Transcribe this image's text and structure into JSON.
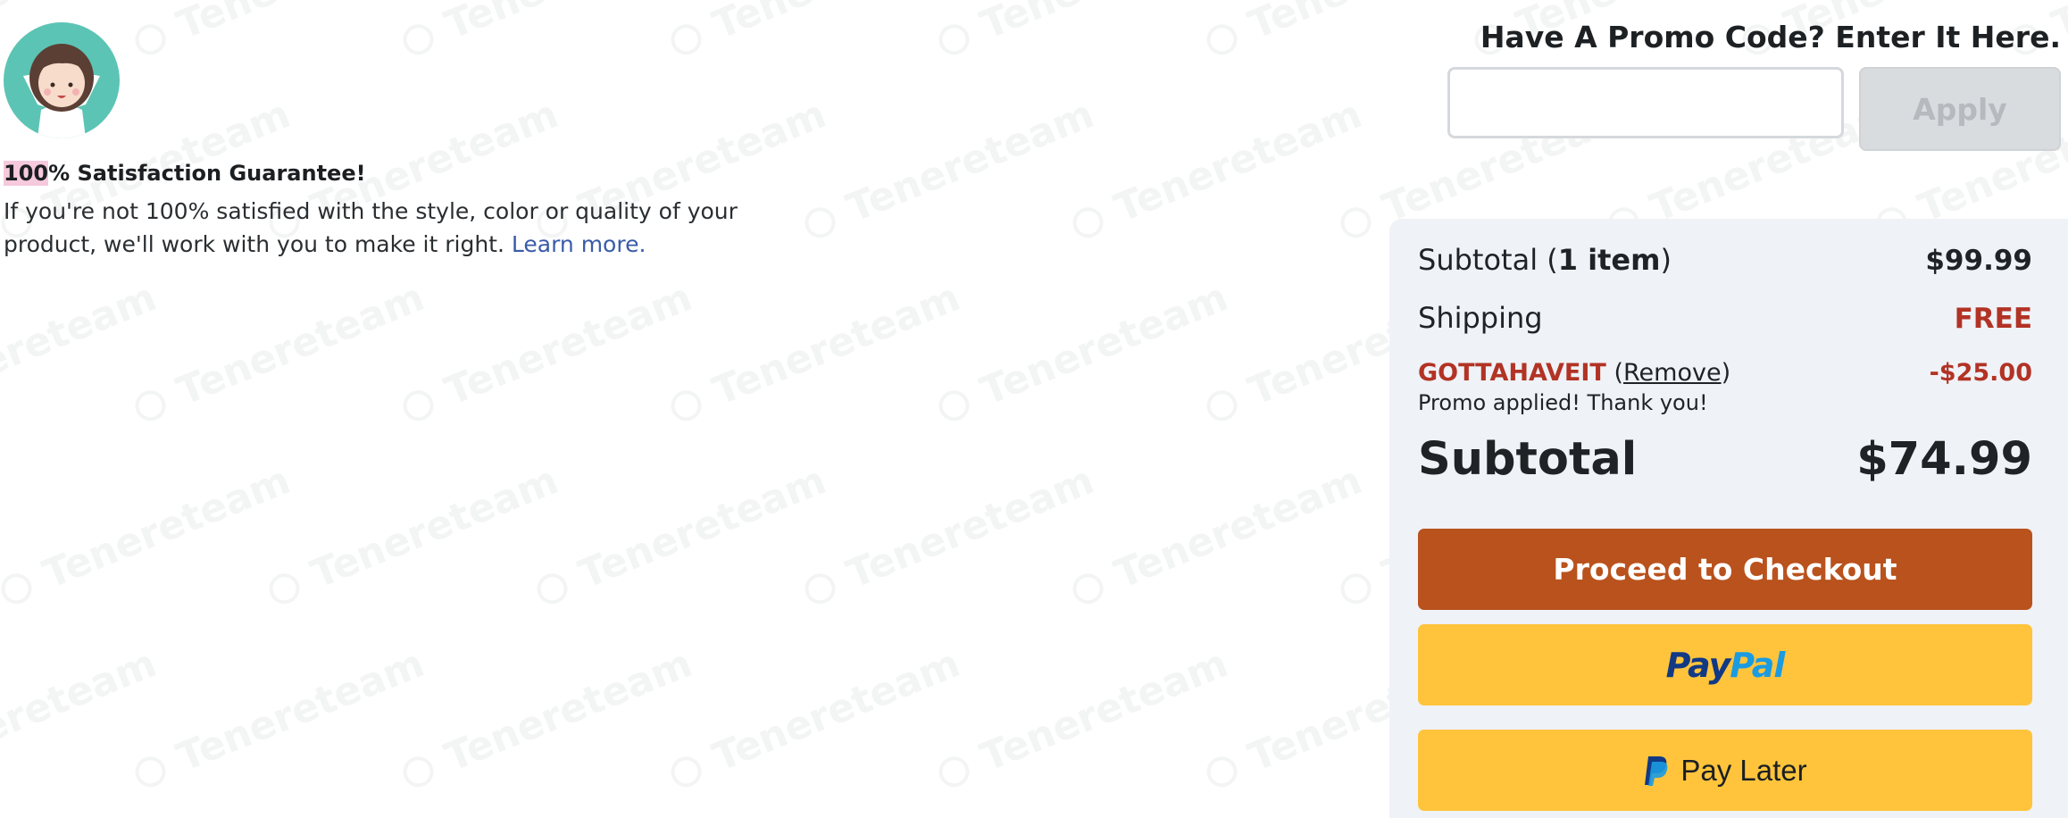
{
  "watermark": {
    "text": "Tenereteam"
  },
  "guarantee": {
    "title_highlight": "100",
    "title_rest": "% Satisfaction Guarantee!",
    "text": "If you're not 100% satisfied with the style, color or quality of your product, we'll work with you to make it right.",
    "link": "Learn more."
  },
  "promo": {
    "title": "Have A Promo Code? Enter It Here.",
    "input_value": "",
    "apply_label": "Apply"
  },
  "summary": {
    "subtotal_label_prefix": "Subtotal (",
    "subtotal_items": "1 item",
    "subtotal_label_suffix": ")",
    "subtotal_value": "$99.99",
    "shipping_label": "Shipping",
    "shipping_value": "FREE",
    "promo_code": "GOTTAHAVEIT",
    "remove_open": "(",
    "remove_label": "Remove",
    "remove_close": ")",
    "discount_value": "-$25.00",
    "promo_message": "Promo applied! Thank you!",
    "total_label": "Subtotal",
    "total_value": "$74.99",
    "checkout_label": "Proceed to Checkout",
    "paypal_pay": "Pay",
    "paypal_pal": "Pal",
    "paylater_label": "Pay Later"
  },
  "colors": {
    "accent_red": "#b23325",
    "checkout_orange": "#b9521d",
    "paypal_yellow": "#ffc43c",
    "link_blue": "#3a5ba8"
  },
  "icons": [
    "avatar-illustration",
    "paypal-p-icon"
  ]
}
